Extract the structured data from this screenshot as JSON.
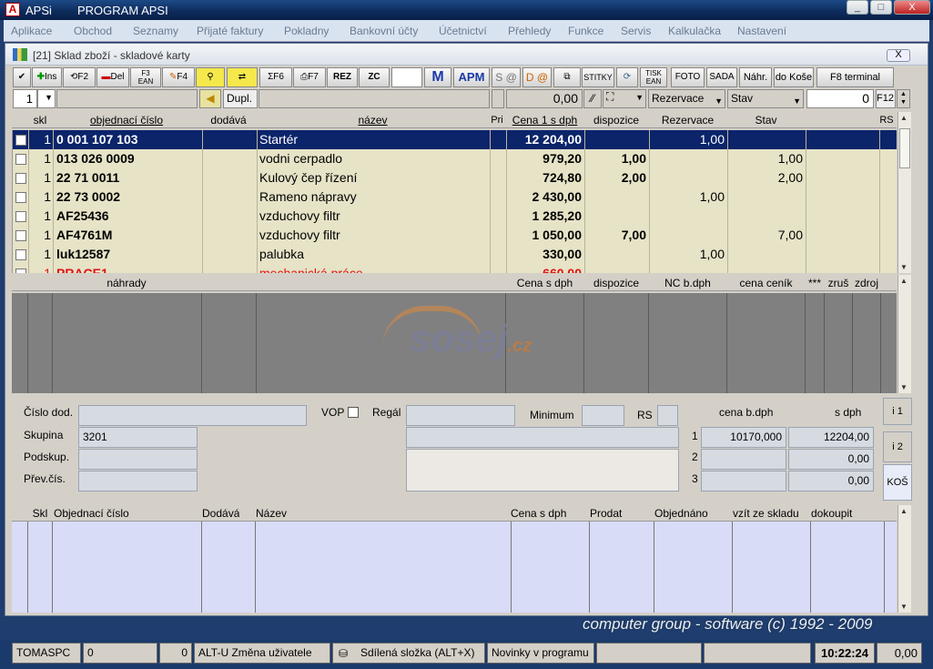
{
  "window": {
    "app_name": "APSi",
    "title": "PROGRAM APSI",
    "buttons": [
      "_",
      "□",
      "X"
    ]
  },
  "menu": [
    "Aplikace",
    "Obchod",
    "Seznamy",
    "Přijaté faktury",
    "Pokladny",
    "Bankovní účty",
    "Účetnictví",
    "Přehledy",
    "Funkce",
    "Servis",
    "Kalkulačka",
    "Nastavení"
  ],
  "subwindow": {
    "title": "[21]  Sklad zboží - skladové karty",
    "close": "X"
  },
  "toolbar": {
    "ins": "Ins",
    "f2": "F2",
    "del": "Del",
    "f3": "F3",
    "ean": "EAN",
    "f4": "F4",
    "f6": "F6",
    "f7": "F7",
    "rez": "REZ",
    "zc": "ZC",
    "m": "M",
    "apm": "APM",
    "s_at": "S @",
    "d_at": "D @",
    "stitky": "STITKY",
    "tisk": "TISK",
    "tisk_ean": "EAN",
    "foto": "FOTO",
    "sada": "SADA",
    "nahr": "Náhr.",
    "do_kose": "do Koše",
    "f8": "F8 terminal"
  },
  "filter": {
    "skl_value": "1",
    "dupl": "Dupl.",
    "price": "0,00",
    "rezervace": "Rezervace",
    "stav": "Stav",
    "count": "0",
    "f12": "F12"
  },
  "grid": {
    "headers": {
      "skl": "skl",
      "objednaci": "objednací číslo",
      "dodava": "dodává",
      "nazev": "název",
      "pri": "Pri",
      "cena": "Cena 1 s dph",
      "dispozice": "dispozice",
      "rezervace": "Rezervace",
      "stav": "Stav",
      "rs": "RS"
    },
    "rows": [
      {
        "skl": "1",
        "cislo": "0 001 107 103",
        "nazev": "Startér",
        "cena": "12 204,00",
        "dispozice": "",
        "rezervace": "1,00",
        "stav": ""
      },
      {
        "skl": "1",
        "cislo": "013 026 0009",
        "nazev": "vodni cerpadlo",
        "cena": "979,20",
        "dispozice": "1,00",
        "rezervace": "",
        "stav": "1,00"
      },
      {
        "skl": "1",
        "cislo": "22 71 0011",
        "nazev": "Kulový čep řízení",
        "cena": "724,80",
        "dispozice": "2,00",
        "rezervace": "",
        "stav": "2,00"
      },
      {
        "skl": "1",
        "cislo": "22 73 0002",
        "nazev": "Rameno nápravy",
        "cena": "2 430,00",
        "dispozice": "",
        "rezervace": "1,00",
        "stav": ""
      },
      {
        "skl": "1",
        "cislo": "AF25436",
        "nazev": "vzduchovy filtr",
        "cena": "1 285,20",
        "dispozice": "",
        "rezervace": "",
        "stav": ""
      },
      {
        "skl": "1",
        "cislo": "AF4761M",
        "nazev": "vzduchovy filtr",
        "cena": "1 050,00",
        "dispozice": "7,00",
        "rezervace": "",
        "stav": "7,00"
      },
      {
        "skl": "1",
        "cislo": "luk12587",
        "nazev": "palubka",
        "cena": "330,00",
        "dispozice": "",
        "rezervace": "1,00",
        "stav": ""
      },
      {
        "skl": "1",
        "cislo": "PRACE1",
        "nazev": "mechanická práce",
        "cena": "660,00",
        "dispozice": "",
        "rezervace": "",
        "stav": ""
      }
    ]
  },
  "substitutes": {
    "headers": {
      "nahrady": "náhrady",
      "cena": "Cena s dph",
      "dispozice": "dispozice",
      "nc": "NC b.dph",
      "cenik": "cena ceník",
      "stars": "***",
      "zrus": "zruš",
      "zdroj": "zdroj"
    },
    "watermark": "sosej",
    "watermark_tld": ".cz"
  },
  "detail": {
    "cislo_dod": "Číslo dod.",
    "vop": "VOP",
    "regal": "Regál",
    "minimum": "Minimum",
    "rs": "RS",
    "skupina": "Skupina",
    "skupina_value": "3201",
    "podskup": "Podskup.",
    "prev_cis": "Přev.čís.",
    "cena_bdph": "cena b.dph",
    "s_dph": "s dph",
    "prices": [
      {
        "n": "1",
        "bdph": "10170,000",
        "sdph": "12204,00"
      },
      {
        "n": "2",
        "bdph": "",
        "sdph": "0,00"
      },
      {
        "n": "3",
        "bdph": "",
        "sdph": "0,00"
      }
    ],
    "tabs": [
      "i 1",
      "i 2",
      "KOŠ"
    ]
  },
  "basket": {
    "headers": {
      "skl": "Skl",
      "objednaci": "Objednací číslo",
      "dodava": "Dodává",
      "nazev": "Název",
      "cena": "Cena s dph",
      "prodat": "Prodat",
      "objednano": "Objednáno",
      "vzit": "vzít ze skladu",
      "dokoupit": "dokoupit"
    }
  },
  "footer": {
    "copyright": "computer group - software    (c) 1992 - 2009",
    "station": "TOMASPC",
    "val1": "0",
    "val2": "0",
    "user": "ALT-U Změna uživatele",
    "shared": "Sdílená složka (ALT+X)",
    "news": "Novinky v programu",
    "time": "10:22:24",
    "total": "0,00"
  },
  "colors": {
    "selected_row": "#0b246a",
    "grid_bg": "#e6e3c7",
    "basket_bg": "#d9dcf7",
    "warning_text": "#e01010"
  }
}
